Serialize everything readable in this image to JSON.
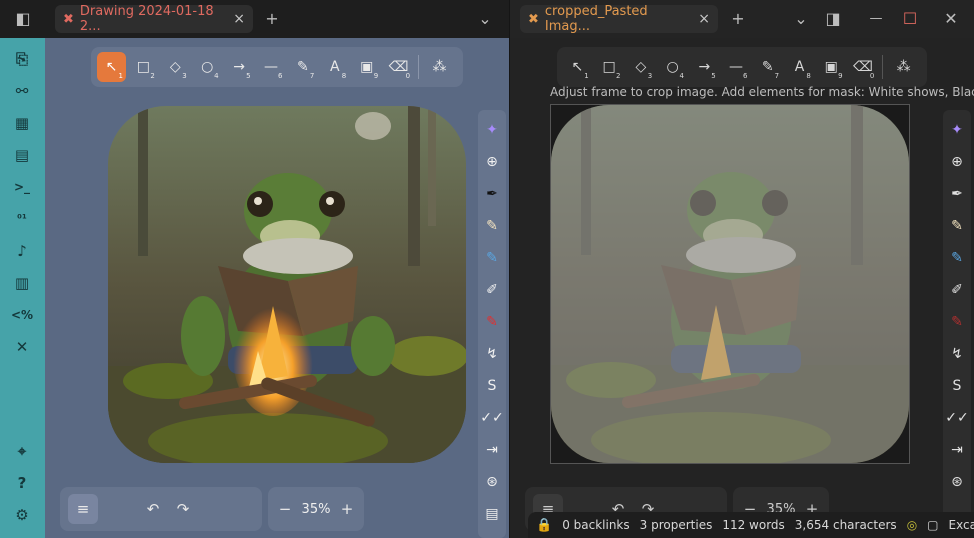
{
  "titlebar": {
    "left_tab": {
      "icon": "excalidraw-icon",
      "title": "Drawing 2024-01-18 2...",
      "close": "×"
    },
    "right_tab": {
      "icon": "excalidraw-icon",
      "title": "cropped_Pasted Imag...",
      "close": "×"
    },
    "new_tab": "+",
    "chevron": "⌄",
    "minimize": "—",
    "maximize": "☐",
    "close": "✕"
  },
  "ribbon": {
    "items": [
      "open-file-icon",
      "graph-icon",
      "canvas-icon",
      "calendar-icon",
      "terminal-icon",
      "binary-icon",
      "mic-icon",
      "template-icon",
      "code-icon",
      "excalidraw-icon",
      "map-pin-icon",
      "help-icon",
      "settings-icon"
    ],
    "glyphs": [
      "⎘",
      "⚯",
      "▦",
      "▤",
      ">_",
      "⁰¹",
      "🎙",
      "▥",
      "<%",
      "✕",
      "⌖",
      "?",
      "⚙"
    ]
  },
  "toolbar": {
    "tools": [
      {
        "name": "selection",
        "glyph": "↖",
        "key": "1",
        "active": true
      },
      {
        "name": "rectangle",
        "glyph": "□",
        "key": "2"
      },
      {
        "name": "diamond",
        "glyph": "◇",
        "key": "3"
      },
      {
        "name": "ellipse",
        "glyph": "○",
        "key": "4"
      },
      {
        "name": "arrow",
        "glyph": "→",
        "key": "5"
      },
      {
        "name": "line",
        "glyph": "—",
        "key": "6"
      },
      {
        "name": "draw",
        "glyph": "✎",
        "key": "7"
      },
      {
        "name": "text",
        "glyph": "A",
        "key": "8"
      },
      {
        "name": "image",
        "glyph": "▣",
        "key": "9"
      },
      {
        "name": "eraser",
        "glyph": "⌫",
        "key": "0"
      }
    ],
    "extra": "⁂"
  },
  "hint": "Adjust frame to crop image. Add elements for mask: White shows, Black h",
  "side_tools": [
    "✦",
    "⊕",
    "✒",
    "✎",
    "✎",
    "✐",
    "✎",
    "↯",
    "S",
    "✓✓",
    "⇥",
    "⊛",
    "▤",
    "↻"
  ],
  "bottom": {
    "menu": "≡",
    "undo": "↶",
    "redo": "↷",
    "zoom_out": "−",
    "zoom_in": "+",
    "zoom_left": "35%",
    "zoom_right": "35%"
  },
  "status": {
    "backlinks": "0 backlinks",
    "properties": "3 properties",
    "words": "112 words",
    "characters": "3,654 characters",
    "plugin": "ExcaliBrain"
  },
  "colors": {
    "accent": "#e5793c",
    "ribbon": "#46a3a9",
    "canvas_left": "#5a6983",
    "canvas_right": "#232323"
  }
}
